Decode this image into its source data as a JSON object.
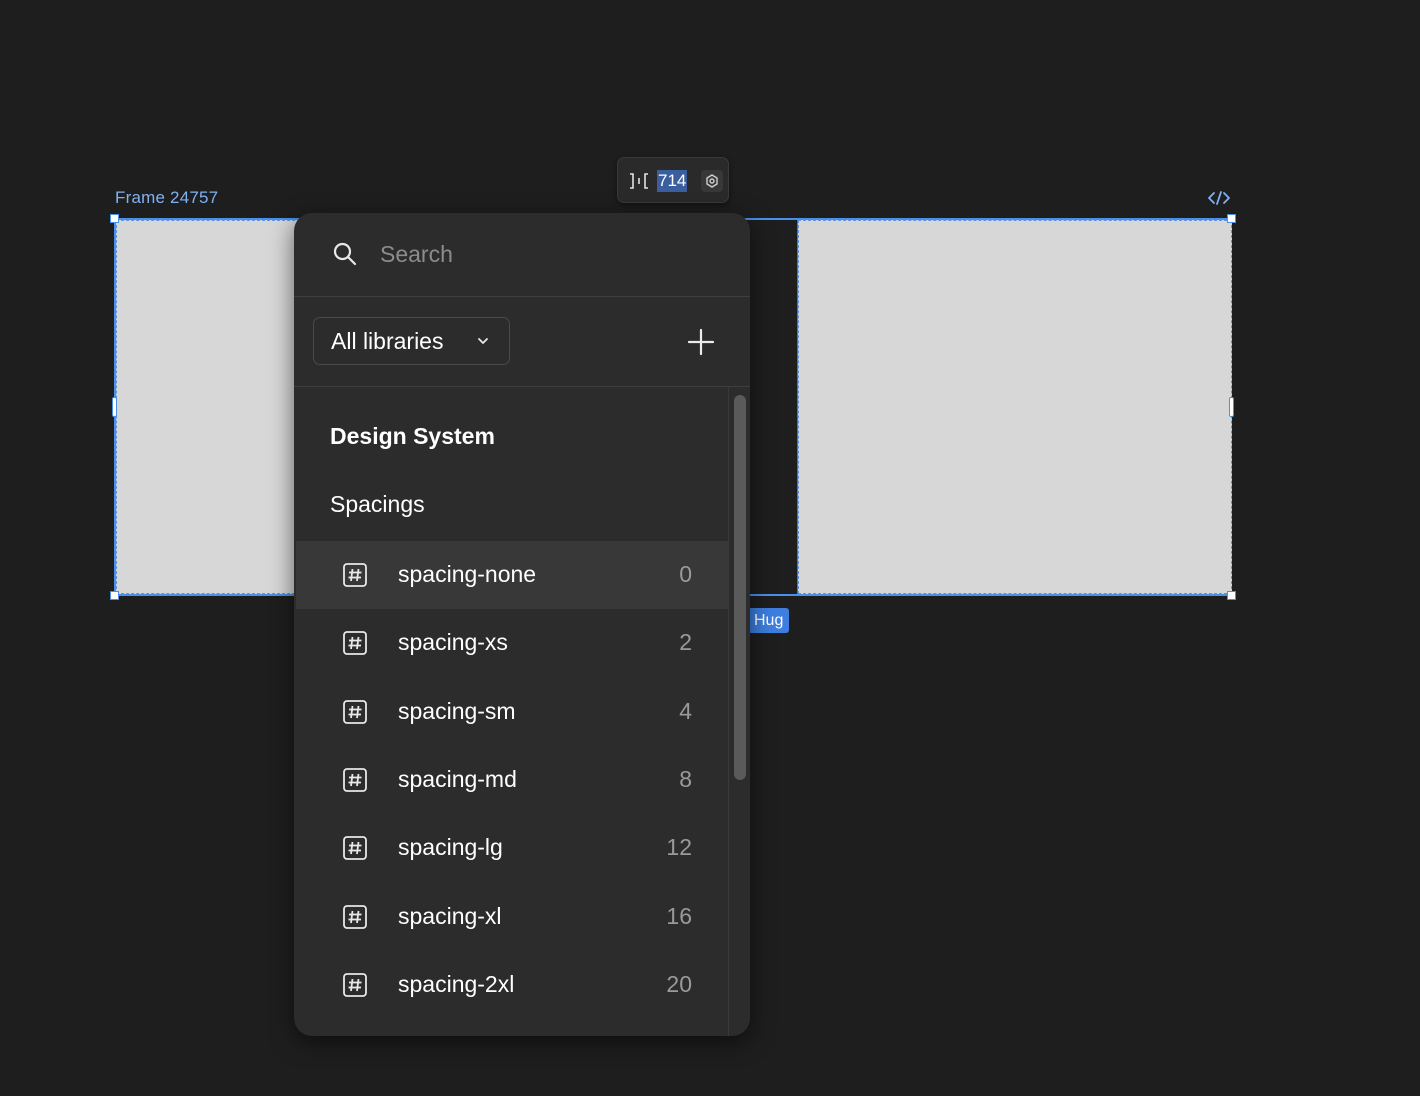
{
  "canvas": {
    "frame_name": "Frame 24757",
    "gap_value": "714",
    "hug_label": "Hug",
    "code_icon": "code-icon"
  },
  "picker": {
    "search_placeholder": "Search",
    "library_filter": "All libraries",
    "collection": "Design System",
    "group": "Spacings",
    "variables": [
      {
        "name": "spacing-none",
        "value": "0"
      },
      {
        "name": "spacing-xs",
        "value": "2"
      },
      {
        "name": "spacing-sm",
        "value": "4"
      },
      {
        "name": "spacing-md",
        "value": "8"
      },
      {
        "name": "spacing-lg",
        "value": "12"
      },
      {
        "name": "spacing-xl",
        "value": "16"
      },
      {
        "name": "spacing-2xl",
        "value": "20"
      }
    ]
  },
  "colors": {
    "selection": "#4a90e8",
    "gap_indicator": "#e0317a",
    "canvas_bg": "#1e1e1e",
    "panel_bg": "#2c2c2c"
  }
}
